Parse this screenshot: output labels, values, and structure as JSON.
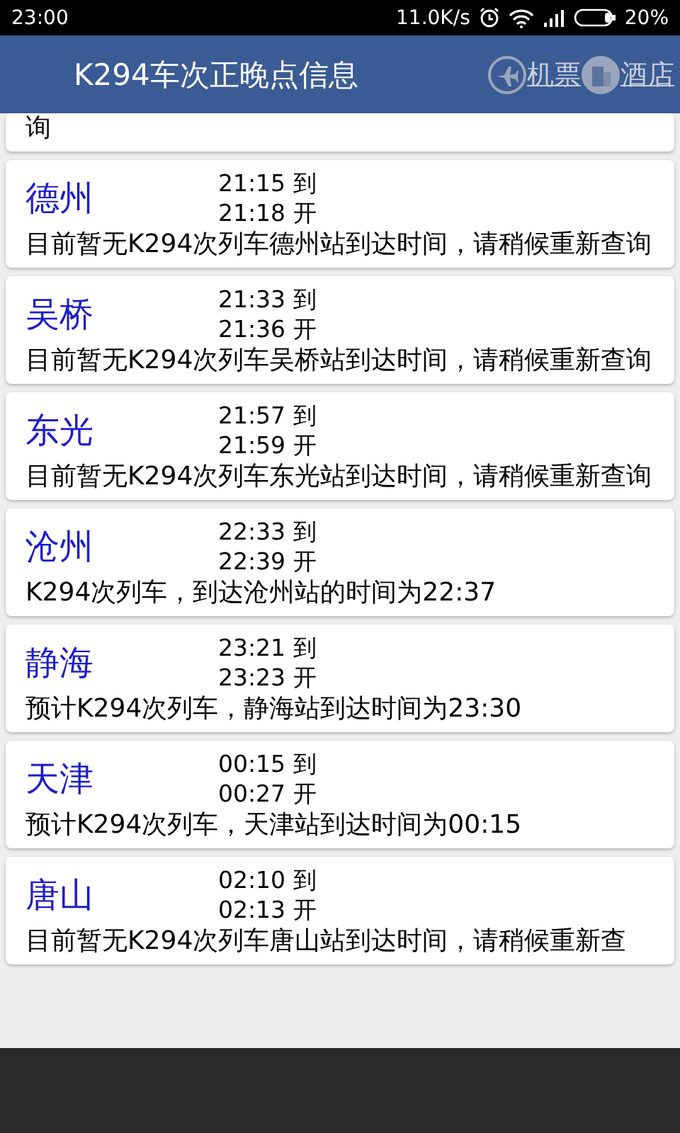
{
  "status_bar": {
    "time": "23:00",
    "speed": "11.0K/s",
    "battery": "20%"
  },
  "header": {
    "title": "K294车次正晚点信息",
    "actions": [
      {
        "label": "机票",
        "kind": "plane"
      },
      {
        "label": "酒店",
        "kind": "hotel"
      }
    ]
  },
  "stations": [
    {
      "note": "询"
    },
    {
      "name": "德州",
      "arrive": "21:15 到",
      "depart": "21:18 开",
      "note": "目前暂无K294次列车德州站到达时间，请稍候重新查询"
    },
    {
      "name": "吴桥",
      "arrive": "21:33 到",
      "depart": "21:36 开",
      "note": "目前暂无K294次列车吴桥站到达时间，请稍候重新查询"
    },
    {
      "name": "东光",
      "arrive": "21:57 到",
      "depart": "21:59 开",
      "note": "目前暂无K294次列车东光站到达时间，请稍候重新查询"
    },
    {
      "name": "沧州",
      "arrive": "22:33 到",
      "depart": "22:39 开",
      "note": "K294次列车，到达沧州站的时间为22:37"
    },
    {
      "name": "静海",
      "arrive": "23:21 到",
      "depart": "23:23 开",
      "note": "预计K294次列车，静海站到达时间为23:30"
    },
    {
      "name": "天津",
      "arrive": "00:15 到",
      "depart": "00:27 开",
      "note": "预计K294次列车，天津站到达时间为00:15"
    },
    {
      "name": "唐山",
      "arrive": "02:10 到",
      "depart": "02:13 开",
      "note": "目前暂无K294次列车唐山站到达时间，请稍候重新查"
    }
  ]
}
